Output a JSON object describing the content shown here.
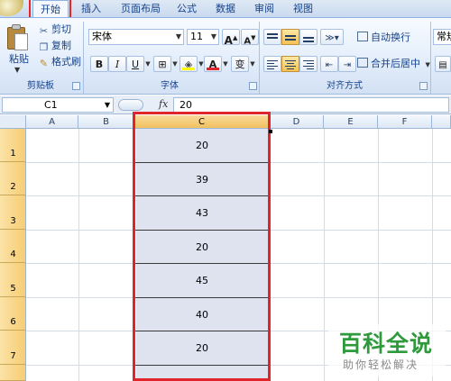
{
  "ribbon_tabs": [
    {
      "label": "开始",
      "active": true
    },
    {
      "label": "插入",
      "active": false
    },
    {
      "label": "页面布局",
      "active": false
    },
    {
      "label": "公式",
      "active": false
    },
    {
      "label": "数据",
      "active": false
    },
    {
      "label": "审阅",
      "active": false
    },
    {
      "label": "视图",
      "active": false
    }
  ],
  "clipboard": {
    "paste_label": "粘贴",
    "cut_label": "剪切",
    "copy_label": "复制",
    "format_painter_label": "格式刷",
    "group_label": "剪贴板"
  },
  "font": {
    "font_name": "宋体",
    "font_size": "11",
    "grow_label": "A",
    "shrink_label": "A",
    "bold_label": "B",
    "italic_label": "I",
    "underline_label": "U",
    "font_color_label": "A",
    "phonetic_label": "变",
    "group_label": "字体",
    "font_color": "#e0242b",
    "highlight_color": "#ffff00"
  },
  "alignment": {
    "wrap_text_label": "自动换行",
    "merge_center_label": "合并后居中",
    "group_label": "对齐方式"
  },
  "number": {
    "format_label": "常规"
  },
  "formula_bar": {
    "name_box": "C1",
    "fx_label": "fx",
    "value": "20"
  },
  "grid": {
    "columns": [
      "A",
      "B",
      "C",
      "D",
      "E",
      "F"
    ],
    "selected_column": "C",
    "rows": [
      "1",
      "2",
      "3",
      "4",
      "5",
      "6",
      "7"
    ],
    "column_c_values": [
      "20",
      "39",
      "43",
      "20",
      "45",
      "40",
      "20"
    ]
  },
  "watermark": {
    "logo_text": "百科全说",
    "slogan": "助你轻松解决"
  }
}
